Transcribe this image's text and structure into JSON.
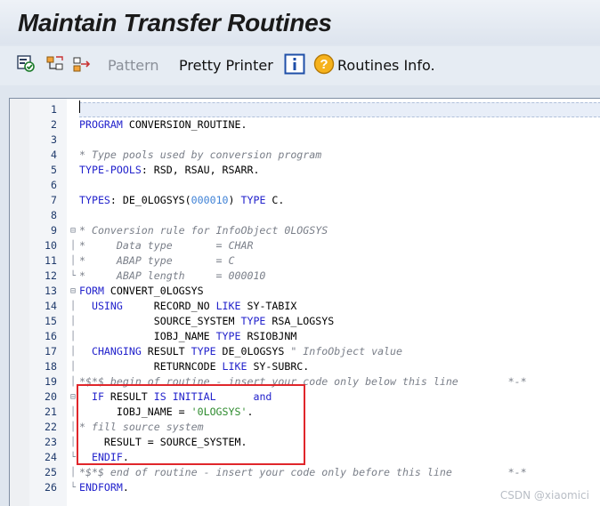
{
  "window": {
    "title": "Maintain Transfer Routines"
  },
  "toolbar": {
    "pattern_label": "Pattern",
    "pretty_printer_label": "Pretty Printer",
    "routines_info_label": "Routines Info."
  },
  "editor": {
    "lines": [
      {
        "n": "1",
        "fold": "",
        "segs": []
      },
      {
        "n": "2",
        "fold": "",
        "segs": [
          [
            "kw",
            "PROGRAM "
          ],
          [
            "pl",
            "CONVERSION_ROUTINE."
          ]
        ]
      },
      {
        "n": "3",
        "fold": "",
        "segs": []
      },
      {
        "n": "4",
        "fold": "",
        "segs": [
          [
            "cm",
            "* Type pools used by conversion program"
          ]
        ]
      },
      {
        "n": "5",
        "fold": "",
        "segs": [
          [
            "kw",
            "TYPE-POOLS"
          ],
          [
            "pl",
            ": RSD, RSAU, RSARR."
          ]
        ]
      },
      {
        "n": "6",
        "fold": "",
        "segs": []
      },
      {
        "n": "7",
        "fold": "",
        "segs": [
          [
            "kw",
            "TYPES"
          ],
          [
            "pl",
            ": DE_0LOGSYS("
          ],
          [
            "nm",
            "000010"
          ],
          [
            "pl",
            ") "
          ],
          [
            "kw",
            "TYPE"
          ],
          [
            "pl",
            " C."
          ]
        ]
      },
      {
        "n": "8",
        "fold": "",
        "segs": []
      },
      {
        "n": "9",
        "fold": "⊟",
        "segs": [
          [
            "cm",
            "* Conversion rule for InfoObject 0LOGSYS"
          ]
        ]
      },
      {
        "n": "10",
        "fold": "│",
        "segs": [
          [
            "cm",
            "*     Data type       = CHAR"
          ]
        ]
      },
      {
        "n": "11",
        "fold": "│",
        "segs": [
          [
            "cm",
            "*     ABAP type       = C"
          ]
        ]
      },
      {
        "n": "12",
        "fold": "└",
        "segs": [
          [
            "cm",
            "*     ABAP length     = 000010"
          ]
        ]
      },
      {
        "n": "13",
        "fold": "⊟",
        "segs": [
          [
            "kw",
            "FORM "
          ],
          [
            "pl",
            "CONVERT_0LOGSYS"
          ]
        ]
      },
      {
        "n": "14",
        "fold": "│",
        "segs": [
          [
            "kw",
            "  USING     "
          ],
          [
            "pl",
            "RECORD_NO "
          ],
          [
            "kw",
            "LIKE"
          ],
          [
            "pl",
            " SY-TABIX"
          ]
        ]
      },
      {
        "n": "15",
        "fold": "│",
        "segs": [
          [
            "pl",
            "            SOURCE_SYSTEM "
          ],
          [
            "kw",
            "TYPE"
          ],
          [
            "pl",
            " RSA_LOGSYS"
          ]
        ]
      },
      {
        "n": "16",
        "fold": "│",
        "segs": [
          [
            "pl",
            "            IOBJ_NAME "
          ],
          [
            "kw",
            "TYPE"
          ],
          [
            "pl",
            " RSIOBJNM"
          ]
        ]
      },
      {
        "n": "17",
        "fold": "│",
        "segs": [
          [
            "kw",
            "  CHANGING "
          ],
          [
            "pl",
            "RESULT "
          ],
          [
            "kw",
            "TYPE"
          ],
          [
            "pl",
            " DE_0LOGSYS "
          ],
          [
            "cm",
            "\" InfoObject value"
          ]
        ]
      },
      {
        "n": "18",
        "fold": "│",
        "segs": [
          [
            "pl",
            "            RETURNCODE "
          ],
          [
            "kw",
            "LIKE"
          ],
          [
            "pl",
            " SY-SUBRC."
          ]
        ]
      },
      {
        "n": "19",
        "fold": "│",
        "segs": [
          [
            "cm",
            "*$*$ begin of routine - insert your code only below this line        *-*"
          ]
        ]
      },
      {
        "n": "20",
        "fold": "⊟",
        "segs": [
          [
            "kw",
            "  IF "
          ],
          [
            "pl",
            "RESULT "
          ],
          [
            "kw",
            "IS INITIAL      and"
          ]
        ]
      },
      {
        "n": "21",
        "fold": "│",
        "segs": [
          [
            "pl",
            "      IOBJ_NAME = "
          ],
          [
            "st",
            "'0LOGSYS'"
          ],
          [
            "pl",
            "."
          ]
        ]
      },
      {
        "n": "22",
        "fold": "│",
        "segs": [
          [
            "cm",
            "* fill source system"
          ]
        ]
      },
      {
        "n": "23",
        "fold": "│",
        "segs": [
          [
            "pl",
            "    RESULT = SOURCE_SYSTEM."
          ]
        ]
      },
      {
        "n": "24",
        "fold": "└",
        "segs": [
          [
            "kw",
            "  ENDIF"
          ],
          [
            "pl",
            "."
          ]
        ]
      },
      {
        "n": "25",
        "fold": "│",
        "segs": [
          [
            "cm",
            "*$*$ end of routine - insert your code only before this line         *-*"
          ]
        ]
      },
      {
        "n": "26",
        "fold": "└",
        "segs": [
          [
            "kw",
            "ENDFORM"
          ],
          [
            "pl",
            "."
          ]
        ]
      }
    ]
  },
  "watermark": "CSDN @xiaomici",
  "colors": {
    "keyword": "#2222cc",
    "comment": "#7a7f89",
    "string": "#2e8b2e",
    "number": "#3f82d6",
    "highlight_box": "#e0262b"
  },
  "icons": [
    "check-syntax-icon",
    "insert-tree-icon",
    "insert-arrow-icon",
    "info-icon",
    "help-icon"
  ]
}
